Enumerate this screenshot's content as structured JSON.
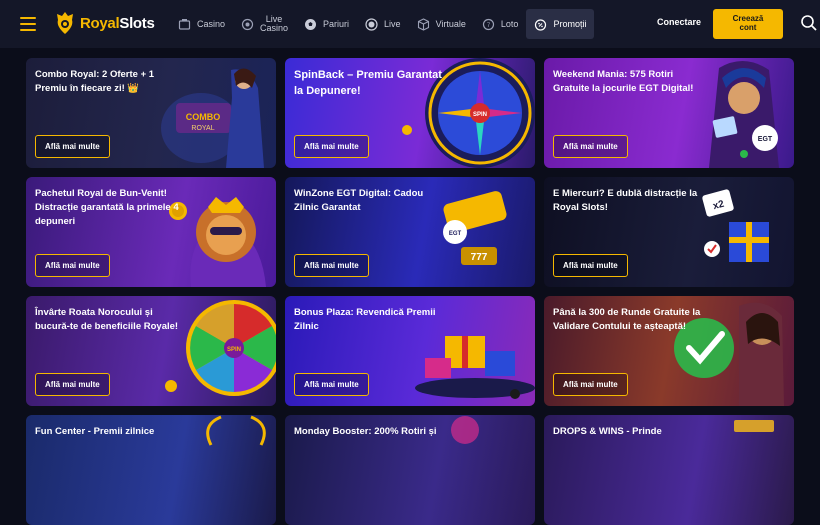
{
  "header": {
    "logo_royal": "Royal",
    "logo_slots": "Slots",
    "nav": [
      {
        "label": "Casino",
        "icon": "casino-icon"
      },
      {
        "label": "Live\nCasino",
        "icon": "live-casino-icon"
      },
      {
        "label": "Pariuri",
        "icon": "ball-icon"
      },
      {
        "label": "Live",
        "icon": "live-icon"
      },
      {
        "label": "Virtuale",
        "icon": "cube-icon"
      },
      {
        "label": "Loto",
        "icon": "lotto-icon"
      },
      {
        "label": "Promoții",
        "icon": "promo-icon"
      }
    ],
    "connect_label": "Conectare",
    "register_label_1": "Creează",
    "register_label_2": "cont"
  },
  "colors": {
    "accent": "#f5b800",
    "bg": "#0b0d1a",
    "topbar": "#141728"
  },
  "cards": [
    {
      "title": "Combo Royal: 2 Oferte + 1 Premiu în fiecare zi! 👑",
      "button": "Află mai multe"
    },
    {
      "title": "SpinBack – Premiu Garantat la Depunere!",
      "button": "Află mai multe"
    },
    {
      "title": "Weekend Mania: 575 Rotiri Gratuite la jocurile EGT Digital!",
      "button": "Află mai multe"
    },
    {
      "title": "Pachetul Royal de Bun-Venit! Distracție garantată la primele 4 depuneri",
      "button": "Află mai multe"
    },
    {
      "title": "WinZone EGT Digital: Cadou Zilnic Garantat",
      "button": "Află mai multe"
    },
    {
      "title": "E Miercuri? E dublă distracție la Royal Slots!",
      "button": "Află mai multe"
    },
    {
      "title": "Învârte Roata Norocului și bucură-te de beneficiile Royale!",
      "button": "Află mai multe"
    },
    {
      "title": "Bonus Plaza: Revendică Premii Zilnic",
      "button": "Află mai multe"
    },
    {
      "title": "Până la 300 de Runde Gratuite la Validare Contului te așteaptă!",
      "button": "Află mai multe"
    },
    {
      "title": "Fun Center - Premii zilnice",
      "button": ""
    },
    {
      "title": "Monday Booster: 200% Rotiri și",
      "button": ""
    },
    {
      "title": "DROPS & WINS - Prinde",
      "button": ""
    }
  ]
}
